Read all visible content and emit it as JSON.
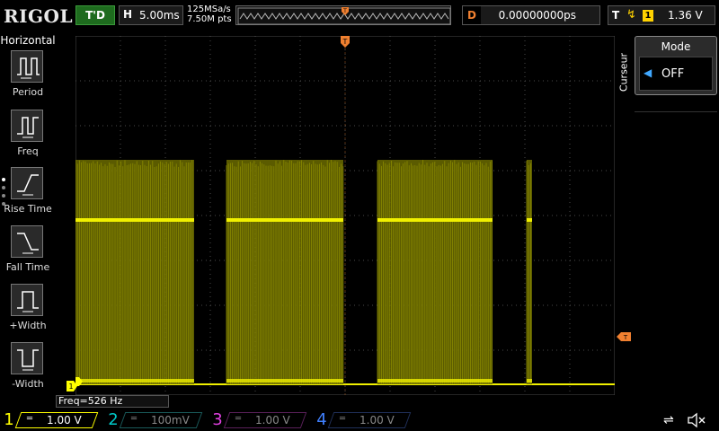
{
  "header": {
    "logo": "RIGOL",
    "run_status": "T'D",
    "timebase_label": "H",
    "timebase": "5.00ms",
    "sample_rate": "125MSa/s",
    "memory_depth": "7.50M pts",
    "delay_label": "D",
    "delay": "0.00000000ps",
    "trigger_label": "T",
    "trigger_edge": "rising-edge-icon",
    "trigger_source": "1",
    "trigger_level": "1.36 V"
  },
  "left_menu": {
    "title": "Horizontal",
    "items": [
      {
        "label": "Period",
        "icon": "period-icon"
      },
      {
        "label": "Freq",
        "icon": "freq-icon"
      },
      {
        "label": "Rise Time",
        "icon": "rise-time-icon"
      },
      {
        "label": "Fall Time",
        "icon": "fall-time-icon"
      },
      {
        "label": "+Width",
        "icon": "pos-width-icon"
      },
      {
        "label": "-Width",
        "icon": "neg-width-icon"
      }
    ]
  },
  "right_menu": {
    "tab": "Curseur",
    "mode_title": "Mode",
    "mode_value": "OFF"
  },
  "measurement": {
    "freq": "Freq=526 Hz"
  },
  "channels": [
    {
      "num": "1",
      "coupling": "DC",
      "scale": "1.00 V",
      "color": "#ffff00",
      "active": true
    },
    {
      "num": "2",
      "coupling": "DC",
      "scale": "100mV",
      "color": "#00c8c8",
      "active": false
    },
    {
      "num": "3",
      "coupling": "DC",
      "scale": "1.00 V",
      "color": "#e040e0",
      "active": false
    },
    {
      "num": "4",
      "coupling": "DC",
      "scale": "1.00 V",
      "color": "#4080ff",
      "active": false
    }
  ],
  "colors": {
    "trace": "#f0f000",
    "trace_fill": "#6b6b00",
    "grid": "#4a4a4a",
    "trigger_marker": "#f08030"
  },
  "waveform": {
    "bursts_ms": [
      [
        0,
        13.2
      ],
      [
        16.8,
        29.8
      ],
      [
        33.6,
        46.4
      ],
      [
        50.2,
        50.8
      ]
    ]
  },
  "footer": {
    "usb_icon": "usb-icon",
    "speaker_icon": "speaker-icon"
  }
}
